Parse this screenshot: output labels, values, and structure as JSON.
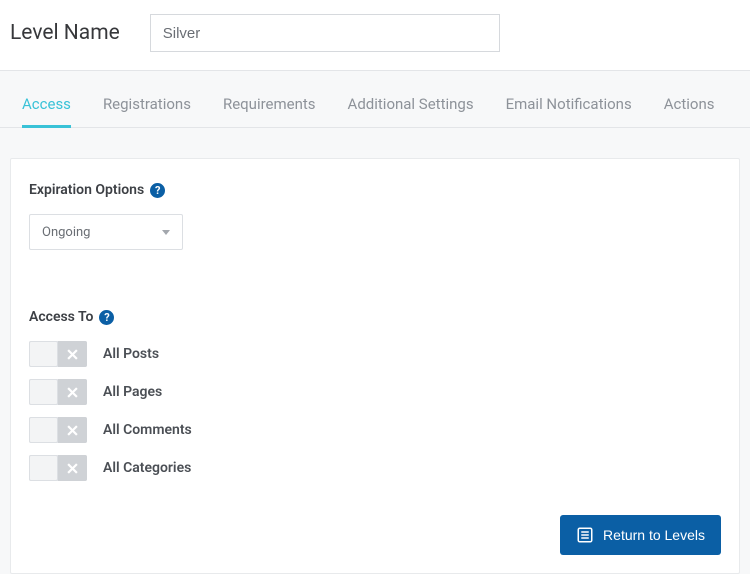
{
  "header": {
    "label": "Level Name",
    "value": "Silver"
  },
  "tabs": [
    {
      "label": "Access",
      "active": true
    },
    {
      "label": "Registrations",
      "active": false
    },
    {
      "label": "Requirements",
      "active": false
    },
    {
      "label": "Additional Settings",
      "active": false
    },
    {
      "label": "Email Notifications",
      "active": false
    },
    {
      "label": "Actions",
      "active": false
    }
  ],
  "expiration": {
    "label": "Expiration Options",
    "value": "Ongoing"
  },
  "access": {
    "label": "Access To",
    "items": [
      {
        "label": "All Posts",
        "on": false
      },
      {
        "label": "All Pages",
        "on": false
      },
      {
        "label": "All Comments",
        "on": false
      },
      {
        "label": "All Categories",
        "on": false
      }
    ]
  },
  "footer": {
    "return_label": "Return to Levels"
  }
}
